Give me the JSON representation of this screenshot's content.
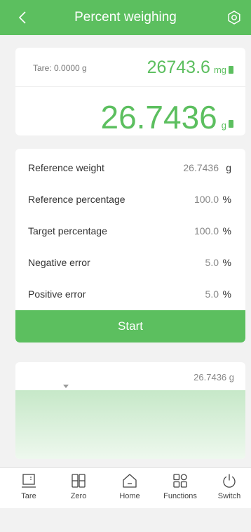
{
  "header": {
    "title": "Percent weighing"
  },
  "weighing": {
    "tare_label": "Tare: 0.0000 g",
    "small_value": "26743.6",
    "small_unit": "mg",
    "big_value": "26.7436",
    "big_unit": "g"
  },
  "params": [
    {
      "label": "Reference weight",
      "value": "26.7436",
      "unit": "g"
    },
    {
      "label": "Reference percentage",
      "value": "100.0",
      "unit": "%"
    },
    {
      "label": "Target percentage",
      "value": "100.0",
      "unit": "%"
    },
    {
      "label": "Negative error",
      "value": "5.0",
      "unit": "%"
    },
    {
      "label": "Positive error",
      "value": "5.0",
      "unit": "%"
    }
  ],
  "start_label": "Start",
  "chart": {
    "readout": "26.7436 g"
  },
  "nav": [
    {
      "label": "Tare",
      "icon": "tare-icon"
    },
    {
      "label": "Zero",
      "icon": "zero-icon"
    },
    {
      "label": "Home",
      "icon": "home-icon"
    },
    {
      "label": "Functions",
      "icon": "functions-icon"
    },
    {
      "label": "Switch",
      "icon": "power-icon"
    }
  ],
  "colors": {
    "accent": "#5cbf5f",
    "background": "#f2f2f2"
  }
}
